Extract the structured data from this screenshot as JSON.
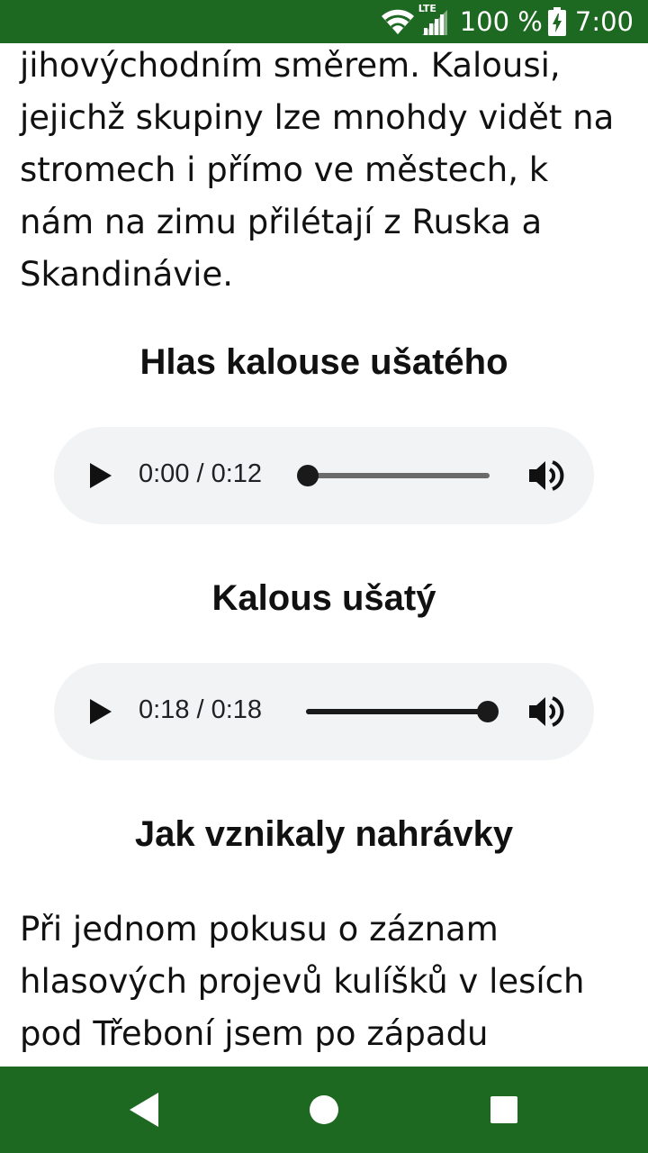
{
  "status_bar": {
    "network_label": "LTE",
    "battery_percent": "100 %",
    "time": "7:00",
    "background_color": "#1e6922"
  },
  "article": {
    "paragraph_top": "jihovýchodním směrem. Kalousi, jejichž skupiny lze mnohdy vidět na stromech i přímo ve městech, k nám na zimu přilétají z Ruska a Skandinávie.",
    "heading_1": "Hlas kalouse ušatého",
    "heading_2": "Kalous ušatý",
    "heading_3": "Jak vznikaly nahrávky",
    "paragraph_bottom": "Při jednom pokusu o záznam hlasových projevů kulíšků v lesích pod Třeboní jsem po západu"
  },
  "audio_players": [
    {
      "time_text": "0:00 / 0:12",
      "progress": 0.0,
      "icons": {
        "play": "play-icon",
        "volume": "volume-icon"
      }
    },
    {
      "time_text": "0:18 / 0:18",
      "progress": 1.0,
      "icons": {
        "play": "play-icon",
        "volume": "volume-icon"
      }
    }
  ],
  "nav_bar": {
    "icons": [
      "back-icon",
      "home-icon",
      "recents-icon"
    ],
    "background_color": "#1e6922"
  }
}
